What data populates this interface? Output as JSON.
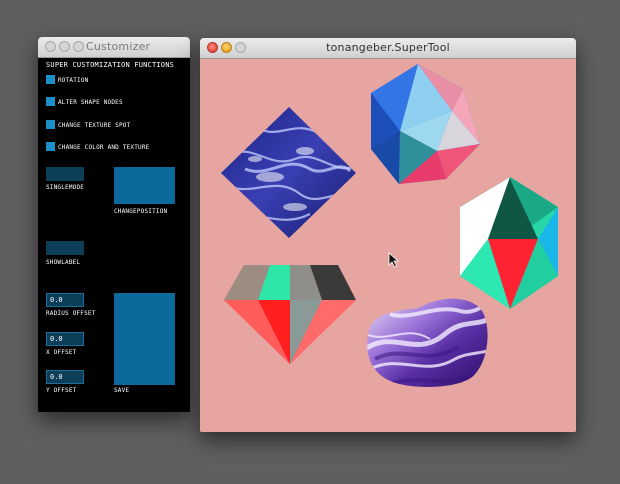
{
  "customizer": {
    "title": "Customizer",
    "header": "SUPER CUSTOMIZATION FUNCTIONS",
    "checkboxes": [
      {
        "label": "ROTATION"
      },
      {
        "label": "ALTER SHAPE NODES"
      },
      {
        "label": "CHANGE TEXTURE SPOT"
      },
      {
        "label": "CHANGE COLOR AND TEXTURE"
      }
    ],
    "singlemode_label": "SINGLEMODE",
    "changeposition_label": "CHANGEPOSITION",
    "showlabel_label": "SHOWLABEL",
    "radius_offset": {
      "value": "0.0",
      "label": "RADIUS OFFSET"
    },
    "x_offset": {
      "value": "0.0",
      "label": "X OFFSET"
    },
    "y_offset": {
      "value": "0.0",
      "label": "Y OFFSET"
    },
    "save_label": "SAVE"
  },
  "supertool": {
    "title": "tonangeber.SuperTool"
  },
  "colors": {
    "canvas_background": "#e6a5a0",
    "control_blue": "#0b6a9b",
    "checkbox_blue": "#1d8fc7"
  }
}
